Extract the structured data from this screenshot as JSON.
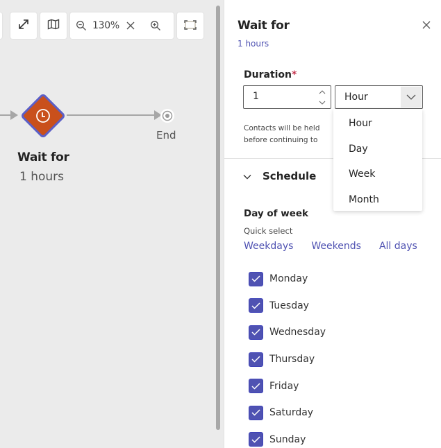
{
  "canvas": {
    "toolbar": {
      "expand_icon": "expand-arrows-icon",
      "map_icon": "map-icon",
      "zoom_out_icon": "zoom-out-icon",
      "zoom_level": "130%",
      "reset_icon": "close-icon",
      "zoom_in_icon": "zoom-in-icon",
      "fit_icon": "fit-to-screen-icon"
    },
    "nodes": {
      "wait": {
        "title": "Wait for",
        "subtitle": "1 hours",
        "icon": "clock-icon",
        "color": "#c9501c",
        "selected_outline": "#5b5fc7"
      },
      "end": {
        "label": "End",
        "icon": "end-target-icon"
      }
    }
  },
  "panel": {
    "title": "Wait for",
    "subtitle": "1 hours",
    "close_icon": "close-icon",
    "duration": {
      "label": "Duration",
      "required_mark": "*",
      "value": "1",
      "unit_selected": "Hour",
      "unit_options": [
        "Hour",
        "Day",
        "Week",
        "Month"
      ],
      "helper_line1": "Contacts will be held",
      "helper_line2": "before continuing to"
    },
    "schedule": {
      "title": "Schedule",
      "expanded": true,
      "day_of_week_label": "Day of week",
      "quick_select_label": "Quick select",
      "quick_links": [
        "Weekdays",
        "Weekends",
        "All days"
      ],
      "days": [
        {
          "label": "Monday",
          "checked": true
        },
        {
          "label": "Tuesday",
          "checked": true
        },
        {
          "label": "Wednesday",
          "checked": true
        },
        {
          "label": "Thursday",
          "checked": true
        },
        {
          "label": "Friday",
          "checked": true
        },
        {
          "label": "Saturday",
          "checked": true
        },
        {
          "label": "Sunday",
          "checked": true
        }
      ]
    }
  },
  "colors": {
    "accent": "#4f52b2",
    "node_orange": "#c9501c",
    "required": "#c4314b"
  }
}
